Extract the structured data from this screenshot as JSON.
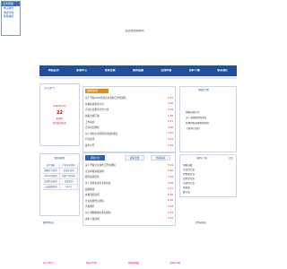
{
  "topbox": {
    "header": "业务导航",
    "links": [
      "电子邮件",
      "电话查询",
      "邮政编码"
    ]
  },
  "tagline": "企业信息服务网",
  "nav": [
    "网站首页",
    "新闻中心",
    "政策法规",
    "服务指南",
    "在线申报",
    "资料下载",
    "联系我们"
  ],
  "left": {
    "weather_title": "今日天气",
    "date_line": "2010年 5月",
    "day": "22",
    "weekday": "星期六",
    "note": "农历四月初九",
    "links_title": "便民服务",
    "grid": [
      "天气预报",
      "手机号码查询",
      "邮编区号查询",
      "身份证查询",
      "列车时刻查询",
      "国际汇率查询",
      "航班信息查询",
      "违章查询",
      "公交线路查询",
      "万年历"
    ],
    "footer_title": "服务热点"
  },
  "news": {
    "title": "最新动态",
    "rows": [
      {
        "t": "关于开展2010年度企业年检工作的通知",
        "d": "5-21"
      },
      {
        "t": "办事指南更新公告",
        "d": "5-20"
      },
      {
        "t": "企业信息服务平台上线",
        "d": "5-19"
      },
      {
        "t": "政策法规汇编",
        "d": "5-18"
      },
      {
        "t": "工作动态",
        "d": "5-17"
      },
      {
        "t": "企业培训通知",
        "d": "5-16"
      },
      {
        "t": "关于举办企业管理培训班的通知",
        "d": "5-15"
      },
      {
        "t": "行业资讯",
        "d": "5-14"
      },
      {
        "t": "政务公开",
        "d": "5-13"
      }
    ]
  },
  "announce": {
    "title": "网站公告",
    "rows": [
      "网站改版公告",
      "关于系统维护的通知",
      "在线申报系统使用说明",
      "下载中心更新"
    ],
    "more_label": "更多"
  },
  "tabs": {
    "labels": [
      "通知公告",
      "政策法规",
      "办事指南"
    ],
    "rows": [
      {
        "t": "关于开展企业调查工作的通知",
        "d": "5-21"
      },
      {
        "t": "企业年报填报说明",
        "d": "5-20"
      },
      {
        "t": "服务指南更新",
        "d": "5-19"
      },
      {
        "t": "关于表彰先进企业的决定",
        "d": "5-18"
      },
      {
        "t": "政策解读",
        "d": "5-17"
      },
      {
        "t": "办事流程说明",
        "d": "5-16"
      },
      {
        "t": "企业注册登记须知",
        "d": "5-15"
      },
      {
        "t": "咨询服务",
        "d": "5-14"
      },
      {
        "t": "关于调整收费标准的通知",
        "d": "5-13"
      },
      {
        "t": "资料下载说明",
        "d": "5-12"
      }
    ]
  },
  "right": {
    "title": "资料下载",
    "more_label": "更多",
    "items": [
      "申报表格",
      "企业登记表",
      "年检报告书",
      "变更登记表",
      "注销登记表",
      "备案表",
      "统计表",
      "其他表格"
    ],
    "bottom_title": "友情链接"
  },
  "footer_links": [
    "关于我们",
    "联系方式",
    "网站地图",
    "法律声明"
  ]
}
